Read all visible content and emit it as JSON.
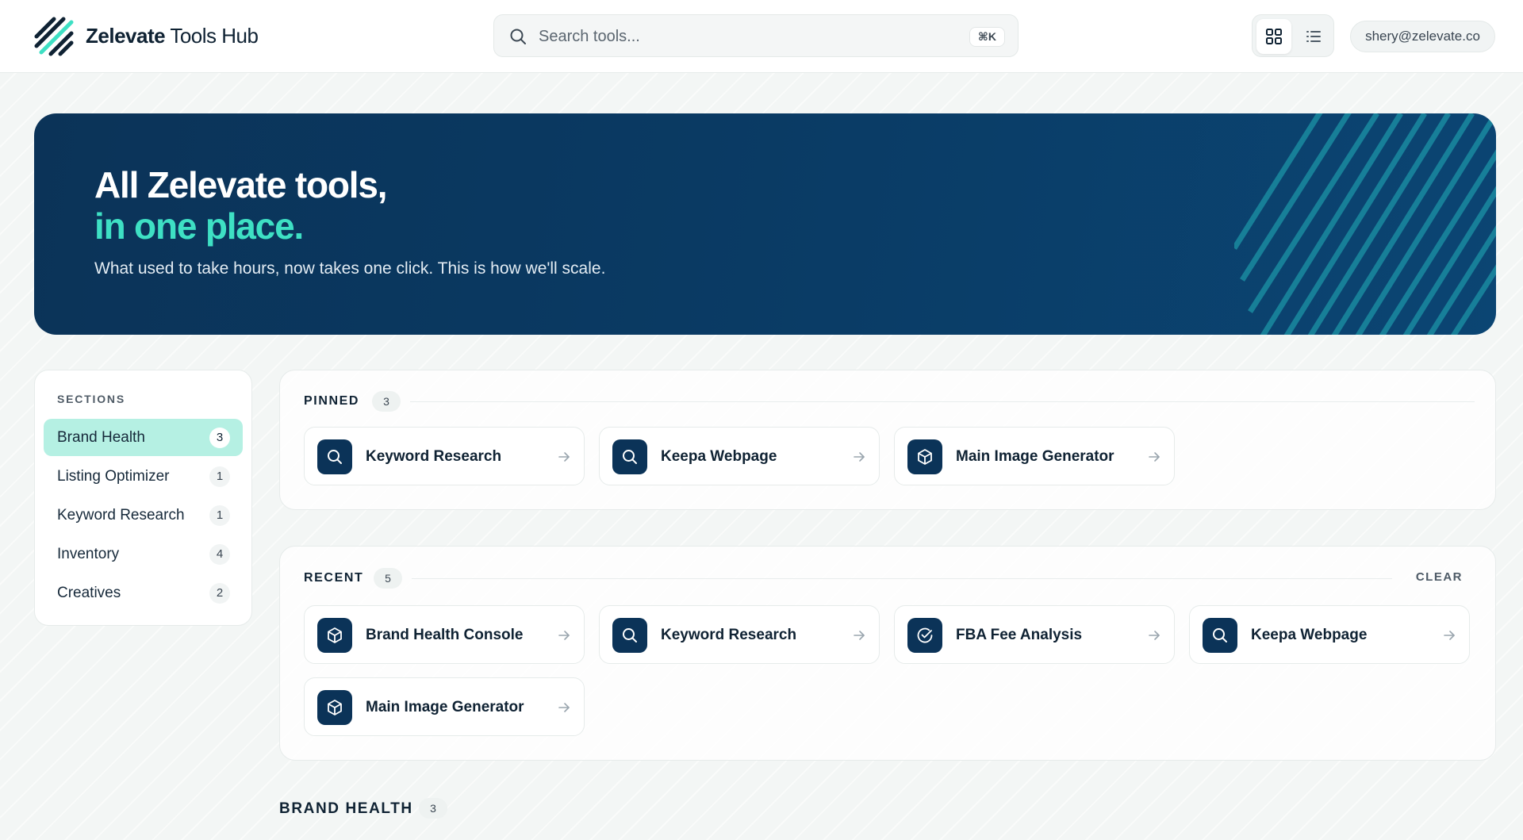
{
  "header": {
    "brand_bold": "Zelevate",
    "brand_rest": " Tools Hub",
    "search_placeholder": "Search tools...",
    "search_shortcut": "⌘K",
    "user_email": "shery@zelevate.co"
  },
  "hero": {
    "title": "All Zelevate tools,",
    "accent": "in one place.",
    "subtitle": "What used to take hours, now takes one click. This is how we'll scale."
  },
  "sidebar": {
    "title": "SECTIONS",
    "items": [
      {
        "label": "Brand Health",
        "count": "3",
        "active": true
      },
      {
        "label": "Listing Optimizer",
        "count": "1"
      },
      {
        "label": "Keyword Research",
        "count": "1"
      },
      {
        "label": "Inventory",
        "count": "4"
      },
      {
        "label": "Creatives",
        "count": "2"
      }
    ]
  },
  "pinned": {
    "title": "PINNED",
    "count": "3",
    "items": [
      {
        "name": "Keyword Research",
        "icon": "search-icon"
      },
      {
        "name": "Keepa Webpage",
        "icon": "search-icon"
      },
      {
        "name": "Main Image Generator",
        "icon": "cube-icon"
      }
    ]
  },
  "recent": {
    "title": "RECENT",
    "count": "5",
    "clear_label": "CLEAR",
    "items": [
      {
        "name": "Brand Health Console",
        "icon": "cube-icon"
      },
      {
        "name": "Keyword Research",
        "icon": "search-icon"
      },
      {
        "name": "FBA Fee Analysis",
        "icon": "check-circle-icon"
      },
      {
        "name": "Keepa Webpage",
        "icon": "search-icon"
      },
      {
        "name": "Main Image Generator",
        "icon": "cube-icon"
      }
    ]
  },
  "brand_health": {
    "title": "BRAND HEALTH",
    "count": "3"
  },
  "colors": {
    "navy": "#0b3358",
    "accent": "#3ee0c4",
    "active_bg": "#b5f0e3"
  }
}
